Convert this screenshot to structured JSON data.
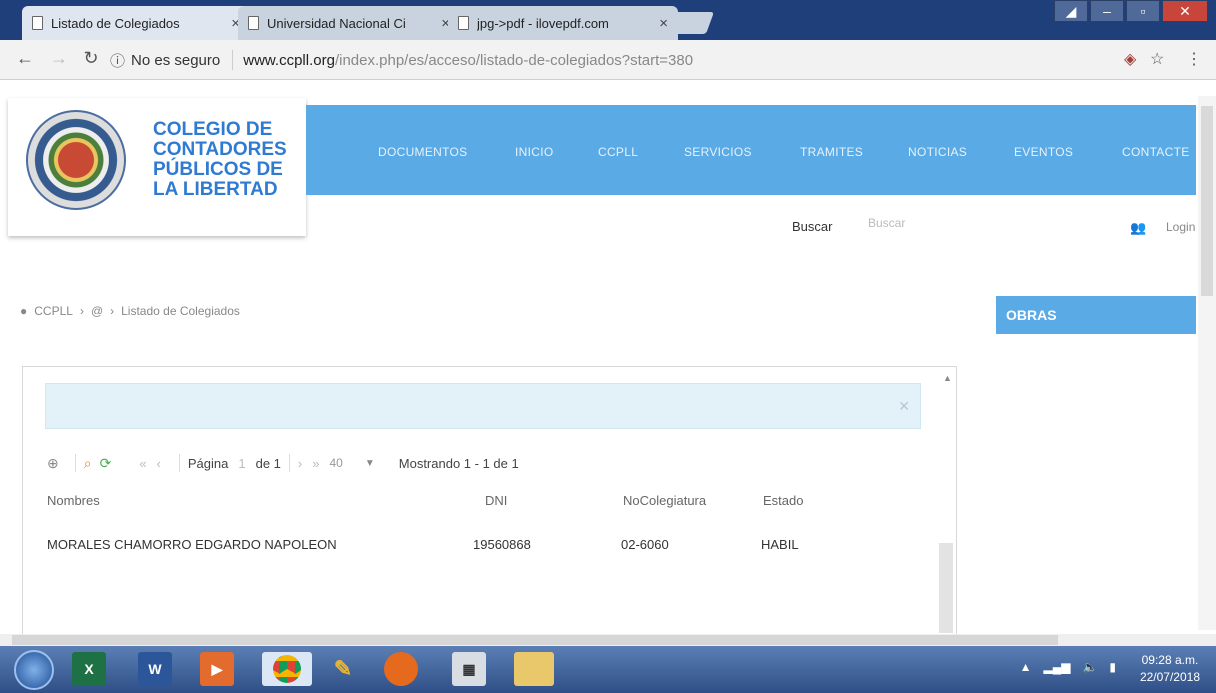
{
  "browser": {
    "tabs": [
      {
        "label": "Listado de Colegiados",
        "close": "×"
      },
      {
        "label": "Universidad Nacional Ci",
        "close": "×"
      },
      {
        "label": "jpg->pdf - ilovepdf.com",
        "close": "×"
      }
    ],
    "address": {
      "security": "No es seguro",
      "host": "www.ccpll.org",
      "path": "/index.php/es/acceso/listado-de-colegiados?start=380"
    }
  },
  "site": {
    "org_name": "COLEGIO DE CONTADORES PÚBLICOS DE LA LIBERTAD",
    "nav": [
      "DOCUMENTOS",
      "INICIO",
      "CCPLL",
      "SERVICIOS",
      "TRAMITES",
      "NOTICIAS",
      "EVENTOS",
      "CONTACTE"
    ],
    "search_label": "Buscar",
    "search_placeholder": "Buscar",
    "login": "Login",
    "breadcrumb": [
      "CCPLL",
      "Listado de Colegiados"
    ],
    "sidebar_title": "OBRAS"
  },
  "grid": {
    "pager": {
      "pagina_label": "Página",
      "page_value": "1",
      "de_label": "de 1",
      "page_size": "40",
      "mostrando": "Mostrando 1 - 1 de 1"
    },
    "columns": [
      "Nombres",
      "DNI",
      "NoColegiatura",
      "Estado"
    ],
    "rows": [
      {
        "nombres": "MORALES CHAMORRO EDGARDO NAPOLEON",
        "dni": "19560868",
        "colegiatura": "02-6060",
        "estado": "HABIL"
      }
    ]
  },
  "taskbar": {
    "time": "09:28 a.m.",
    "date": "22/07/2018"
  },
  "colors": {
    "accent": "#5aaae6",
    "title_blue": "#2f7bd1"
  }
}
